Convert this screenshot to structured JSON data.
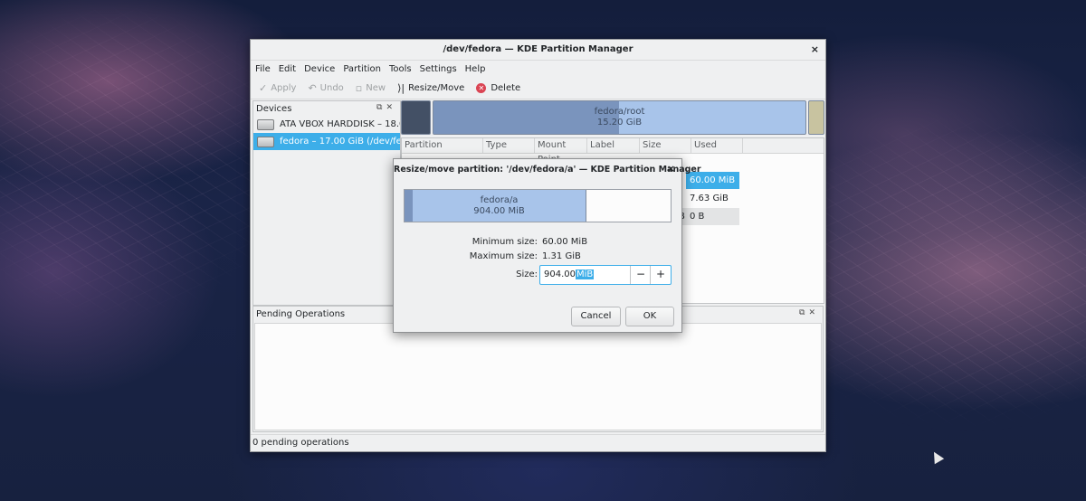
{
  "main_window": {
    "title": "/dev/fedora — KDE Partition Manager",
    "close_glyph": "×",
    "menu": [
      "File",
      "Edit",
      "Device",
      "Partition",
      "Tools",
      "Settings",
      "Help"
    ],
    "toolbar": {
      "apply": "Apply",
      "undo": "Undo",
      "new": "New",
      "resize_move": "Resize/Move",
      "delete": "Delete"
    },
    "devices_panel": {
      "title": "Devices",
      "items": [
        "ATA VBOX HARDDISK – 18.0...",
        "fedora – 17.00 GiB (/dev/fedo..."
      ],
      "selected_index": 1
    },
    "partition_bar": {
      "name": "fedora/root",
      "size": "15.20 GiB"
    },
    "table": {
      "columns": [
        "Partition",
        "Type",
        "Mount Point",
        "Label",
        "Size",
        "Used"
      ],
      "visible_cells": {
        "row1_used": "60.00 MiB",
        "row2_used": "7.63 GiB",
        "row3_size_fragment": "B",
        "row3_used": "0 B"
      }
    },
    "pending_panel": {
      "title": "Pending Operations"
    },
    "status": "0 pending operations"
  },
  "dialog": {
    "title": "Resize/move partition: '/dev/fedora/a' — KDE Partition Manager",
    "close_glyph": "×",
    "partition_name": "fedora/a",
    "partition_size": "904.00 MiB",
    "fill_fraction": 0.67,
    "min_label": "Minimum size:",
    "min_value": "60.00 MiB",
    "max_label": "Maximum size:",
    "max_value": "1.31 GiB",
    "size_label": "Size:",
    "size_number": "904.00",
    "size_unit": "MiB",
    "minus": "−",
    "plus": "+",
    "cancel": "Cancel",
    "ok": "OK"
  },
  "icons": {
    "apply": "check-icon",
    "undo": "undo-icon",
    "new": "new-icon",
    "resize": "resize-icon",
    "delete": "delete-icon"
  }
}
